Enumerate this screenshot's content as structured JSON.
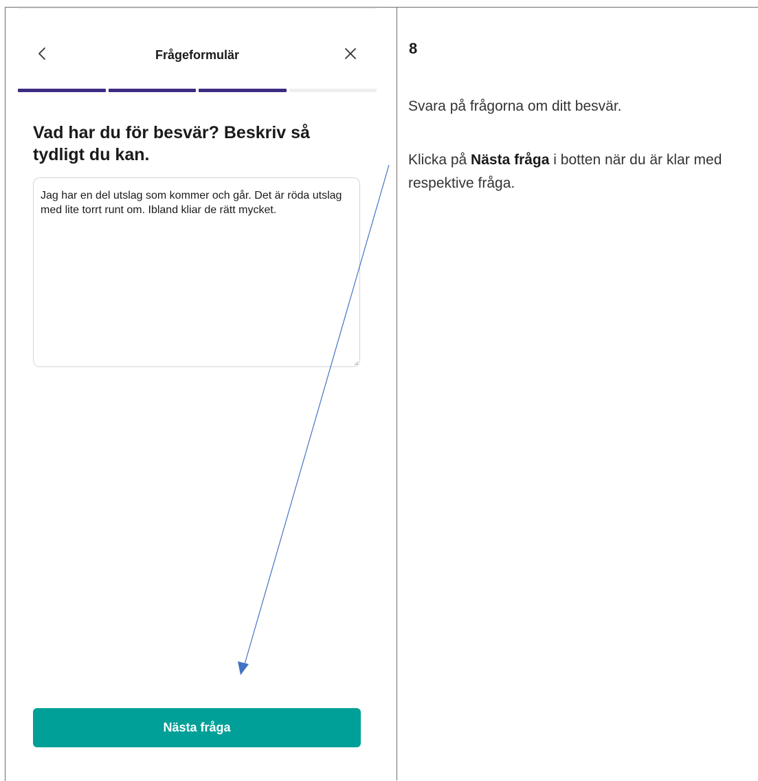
{
  "phone": {
    "nav": {
      "title": "Frågeformulär",
      "back_icon": "chevron-left-icon",
      "close_icon": "close-icon"
    },
    "progress": {
      "total_steps": 4,
      "completed_steps": 3,
      "done_color": "#3d2b82",
      "todo_color": "#eeeeee"
    },
    "question": "Vad har du för besvär? Beskriv så tydligt du kan.",
    "answer": "Jag har en del utslag som kommer och går. Det är röda utslag med lite torrt runt om. Ibland kliar de rätt mycket.",
    "next_button": {
      "label": "Nästa fråga",
      "color": "#00a098"
    }
  },
  "instructions": {
    "step_number": "8",
    "line1": "Svara på frågorna om ditt besvär.",
    "line2_prefix": "Klicka på ",
    "line2_bold": "Nästa fråga",
    "line2_suffix": " i botten när du är klar med respektive fråga.",
    "arrow_color": "#4472c4"
  }
}
